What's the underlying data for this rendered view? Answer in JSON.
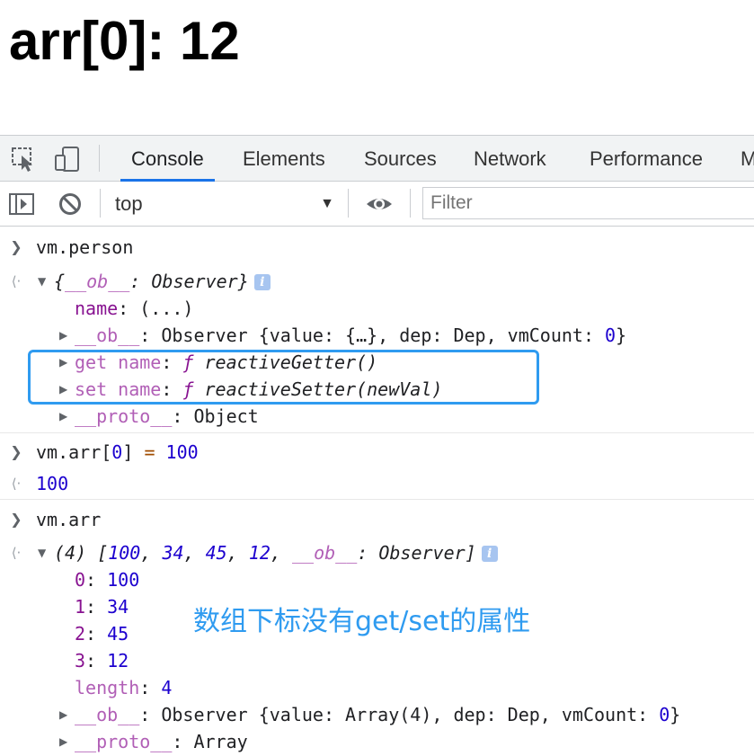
{
  "page": {
    "heading": "arr[0]: 12"
  },
  "devtools": {
    "tabs": [
      "Console",
      "Elements",
      "Sources",
      "Network",
      "Performance",
      "M"
    ],
    "active_tab": "Console",
    "icons": [
      "inspect-element-icon",
      "device-toolbar-icon",
      "sidebar-toggle-icon",
      "clear-console-icon",
      "eye-icon"
    ],
    "context": {
      "value": "top",
      "arrow": "▼"
    },
    "filter": {
      "placeholder": "Filter"
    }
  },
  "console": {
    "cmd1": "vm.person",
    "person": {
      "summary_key": "__ob__",
      "summary_value": "Observer",
      "name_key": "name",
      "name_value": "(...)",
      "ob_key": "__ob__",
      "ob_type": "Observer",
      "ob_body_open": "{value: {…}, dep: Dep, vmCount: ",
      "ob_vmcount": "0",
      "ob_body_close": "}",
      "get_key": "get name",
      "get_value": "reactiveGetter()",
      "set_key": "set name",
      "set_value": "reactiveSetter(newVal)",
      "proto_key": "__proto__",
      "proto_value": "Object",
      "func_glyph": "ƒ"
    },
    "cmd2_left": "vm.arr[",
    "cmd2_index": "0",
    "cmd2_mid": "] ",
    "cmd2_op": "=",
    "cmd2_value": "100",
    "result2": "100",
    "cmd3": "vm.arr",
    "arr": {
      "summary_length": "(4)",
      "summary_values": [
        "100",
        "34",
        "45",
        "12"
      ],
      "summary_ob_key": "__ob__",
      "summary_ob_value": "Observer",
      "items": [
        {
          "key": "0",
          "value": "100"
        },
        {
          "key": "1",
          "value": "34"
        },
        {
          "key": "2",
          "value": "45"
        },
        {
          "key": "3",
          "value": "12"
        }
      ],
      "length_key": "length",
      "length_value": "4",
      "ob_key": "__ob__",
      "ob_type": "Observer",
      "ob_body_open": "{value: Array(4), dep: Dep, vmCount: ",
      "ob_vmcount": "0",
      "ob_body_close": "}",
      "proto_key": "__proto__",
      "proto_value": "Array"
    },
    "info_glyph": "i"
  },
  "annotation": {
    "text": "数组下标没有get/set的属性"
  },
  "colors": {
    "accent": "#1a73e8",
    "annotation": "#2f9bf0",
    "key": "#881391",
    "number": "#1c00cf"
  }
}
